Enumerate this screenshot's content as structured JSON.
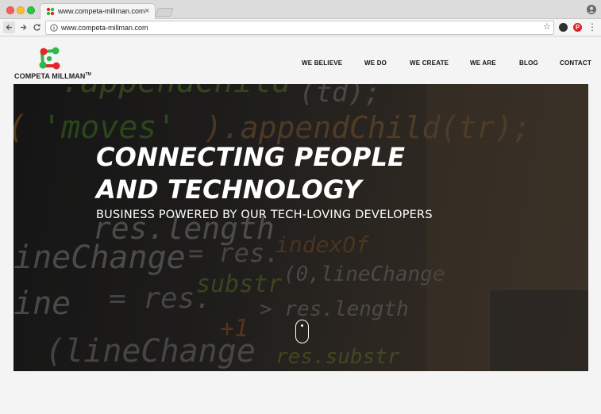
{
  "browser": {
    "tab_title": "www.competa-millman.com",
    "tab_close": "×",
    "url": "www.competa-millman.com",
    "pinterest_glyph": "P"
  },
  "site": {
    "logo_text": "COMPETA MILLMAN",
    "logo_tm": "TM",
    "nav": [
      "WE BELIEVE",
      "WE DO",
      "WE CREATE",
      "WE ARE",
      "BLOG",
      "CONTACT"
    ]
  },
  "hero": {
    "title_line1": "CONNECTING PEOPLE",
    "title_line2": "AND TECHNOLOGY",
    "subtitle": "BUSINESS POWERED BY OUR TECH-LOVING DEVELOPERS"
  },
  "icons": {
    "back": "back-arrow-icon",
    "forward": "forward-arrow-icon",
    "reload": "reload-icon",
    "star": "star-icon",
    "menu": "kebab-menu-icon",
    "scroll": "scroll-mouse-icon"
  },
  "colors": {
    "logo_red": "#e3262b",
    "logo_green": "#2db84a",
    "nav_text": "#111111"
  }
}
